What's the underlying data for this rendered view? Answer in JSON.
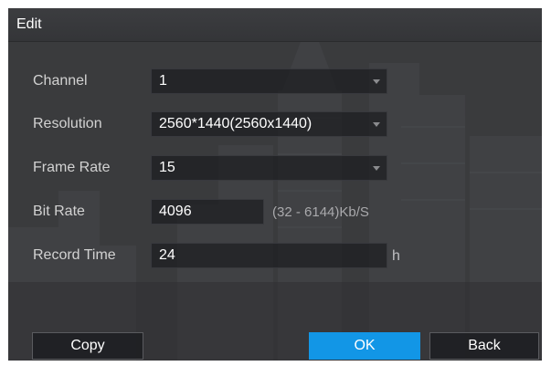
{
  "dialog": {
    "title": "Edit"
  },
  "form": {
    "channel": {
      "label": "Channel",
      "value": "1"
    },
    "resolution": {
      "label": "Resolution",
      "value": "2560*1440(2560x1440)"
    },
    "frame_rate": {
      "label": "Frame Rate",
      "value": "15"
    },
    "bit_rate": {
      "label": "Bit Rate",
      "value": "4096",
      "range": "(32 - 6144)Kb/S"
    },
    "record_time": {
      "label": "Record Time",
      "value": "24",
      "unit": "h"
    }
  },
  "buttons": {
    "copy": "Copy",
    "ok": "OK",
    "back": "Back"
  },
  "colors": {
    "accent": "#1296e6",
    "panel": "#3a3b3d"
  }
}
